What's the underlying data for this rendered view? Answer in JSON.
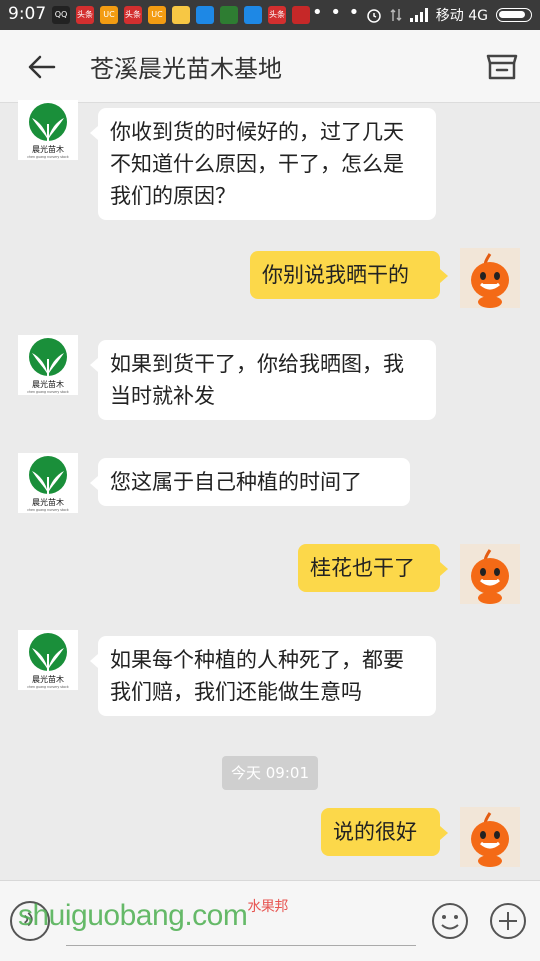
{
  "status_bar": {
    "time": "9:07",
    "carrier": "移动 4G",
    "dots": "• • •",
    "apps": [
      {
        "icon": "penguin-icon",
        "label": "QQ",
        "color": "#222222"
      },
      {
        "icon": "news-icon",
        "label": "头条",
        "color": "#d32f2f"
      },
      {
        "icon": "squirrel-icon",
        "label": "UC",
        "color": "#f39c12"
      },
      {
        "icon": "news-icon",
        "label": "头条",
        "color": "#d32f2f"
      },
      {
        "icon": "squirrel-icon",
        "label": "UC",
        "color": "#f39c12"
      },
      {
        "icon": "folder-icon",
        "label": "",
        "color": "#f7c744"
      },
      {
        "icon": "app-icon",
        "label": "",
        "color": "#1e88e5"
      },
      {
        "icon": "app-icon",
        "label": "",
        "color": "#2e7d32"
      },
      {
        "icon": "app-icon",
        "label": "",
        "color": "#1e88e5"
      },
      {
        "icon": "news-icon",
        "label": "头条",
        "color": "#d32f2f"
      },
      {
        "icon": "video-icon",
        "label": "",
        "color": "#c62828"
      }
    ]
  },
  "header": {
    "title": "苍溪晨光苗木基地"
  },
  "shop_logo": {
    "name": "晨光苗木",
    "subtext": "chen guang nursery stock"
  },
  "messages": [
    {
      "side": "in",
      "text": "你收到货的时候好的，过了几天不知道什么原因，干了，怎么是我们的原因？"
    },
    {
      "side": "out",
      "text": "你别说我晒干的"
    },
    {
      "side": "in",
      "text": "如果到货干了，你给我晒图，我当时就补发"
    },
    {
      "side": "in",
      "text": "您这属于自己种植的时间了"
    },
    {
      "side": "out",
      "text": "桂花也干了"
    },
    {
      "side": "in",
      "text": "如果每个种植的人种死了，都要我们赔，我们还能做生意吗"
    },
    {
      "side": "out",
      "text": "说的很好"
    }
  ],
  "timestamp": "今天 09:01",
  "watermark": {
    "text": "shuiguobang.com",
    "tag": "水果邦"
  },
  "colors": {
    "outgoing_bubble": "#fcd84a",
    "incoming_bubble": "#ffffff",
    "chat_background": "#ebebeb"
  }
}
